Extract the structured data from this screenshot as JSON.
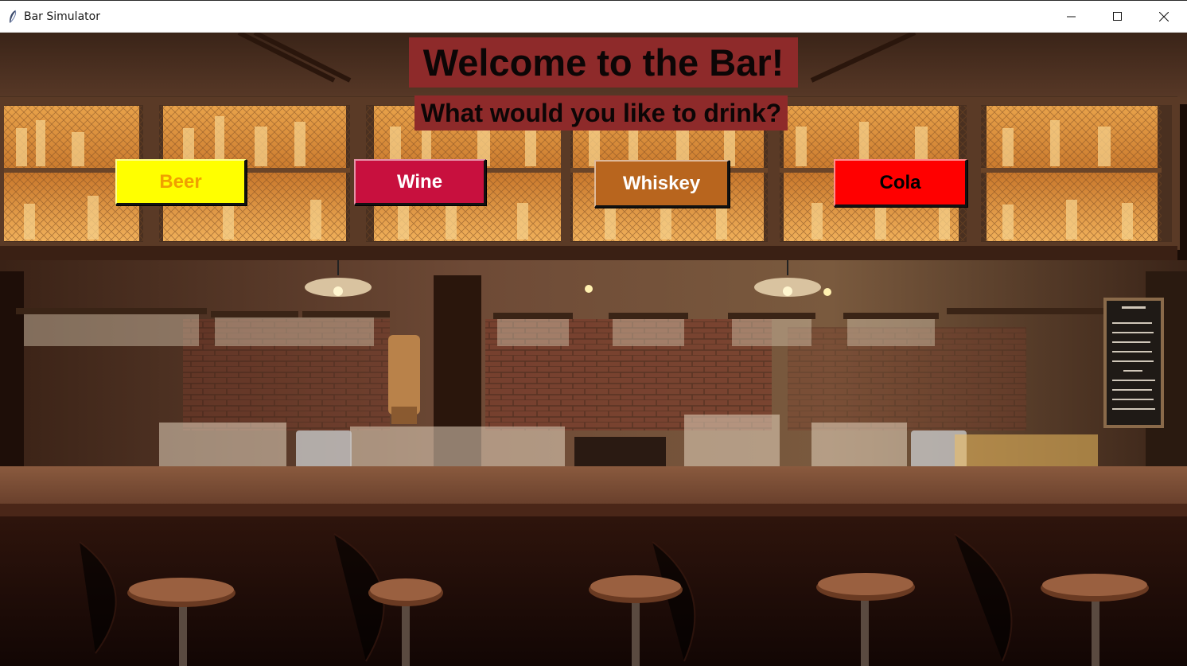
{
  "window": {
    "title": "Bar Simulator",
    "controls": [
      "minimize-icon",
      "maximize-icon",
      "close-icon"
    ]
  },
  "scene": {
    "heading": "Welcome to the Bar!",
    "subheading": "What would you like to drink?",
    "heading_bg": "#8e2a2a",
    "chalkboard": {
      "lines": [
        "DRAFT",
        "AVERY IPA",
        "ALLAGASH WHITE",
        "ABITA LAGER",
        "JAMAICA RED",
        "BAYHAWK PORTER",
        "DOWNTOWN BROWN",
        "CANS",
        "MAMA'S YELLA PILS",
        "WHITE RASCAL",
        "DALE'S PALE ALE",
        "ELLIE'S BROWN ALE",
        "COCONUT PORTER"
      ]
    }
  },
  "buttons": [
    {
      "id": "beer",
      "label": "Beer",
      "bg": "#ffff00",
      "fg": "#f0a000"
    },
    {
      "id": "wine",
      "label": "Wine",
      "bg": "#c8103e",
      "fg": "#ffffff"
    },
    {
      "id": "whiskey",
      "label": "Whiskey",
      "bg": "#b8651e",
      "fg": "#ffffff"
    },
    {
      "id": "cola",
      "label": "Cola",
      "bg": "#ff0000",
      "fg": "#000000"
    }
  ]
}
